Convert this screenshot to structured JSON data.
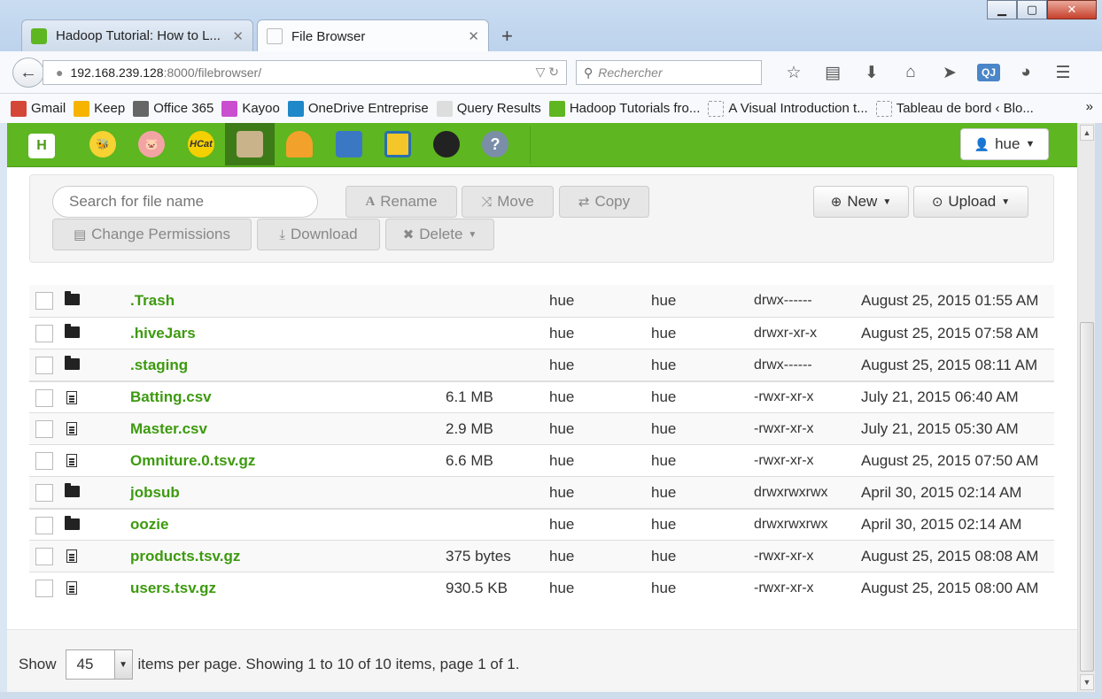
{
  "browser": {
    "tabs": [
      {
        "label": "Hadoop Tutorial: How to L...",
        "icon": "hue-leaf-icon"
      },
      {
        "label": "File Browser",
        "icon": "file-browser-icon"
      }
    ],
    "new_tab": "+",
    "url_host": "192.168.239.128",
    "url_path": ":8000/filebrowser/",
    "search_placeholder": "Rechercher",
    "bookmarks": [
      {
        "label": "Gmail",
        "color": "#d44638"
      },
      {
        "label": "Keep",
        "color": "#f6b400"
      },
      {
        "label": "Office 365",
        "color": "#666666"
      },
      {
        "label": "Kayoo",
        "color": "#c94fcf"
      },
      {
        "label": "OneDrive Entreprise",
        "color": "#1e88c9"
      },
      {
        "label": "Query Results",
        "color": "#bbbbbb"
      },
      {
        "label": "Hadoop Tutorials fro...",
        "color": "#5eb621"
      },
      {
        "label": "A Visual Introduction t...",
        "color": "#cccccc"
      },
      {
        "label": "Tableau de bord ‹ Blo...",
        "color": "#cccccc"
      }
    ],
    "qj_label": "QJ"
  },
  "hue": {
    "user_label": "hue",
    "apps": [
      {
        "name": "hive-icon",
        "label": "",
        "bg": "#f6d233",
        "active": false
      },
      {
        "name": "pig-icon",
        "label": "",
        "bg": "#f2a4a4",
        "active": false
      },
      {
        "name": "hcat-icon",
        "label": "HCat",
        "bg": "#f4d000",
        "active": false
      },
      {
        "name": "file-browser-icon",
        "label": "",
        "bg": "#c8b38a",
        "active": true
      },
      {
        "name": "job-designer-icon",
        "label": "",
        "bg": "#f2a22a",
        "active": false
      },
      {
        "name": "oozie-icon",
        "label": "",
        "bg": "#3b78c4",
        "active": false
      },
      {
        "name": "metastore-icon",
        "label": "",
        "bg": "#f5c629",
        "active": false
      },
      {
        "name": "security-icon",
        "label": "",
        "bg": "#222222",
        "active": false
      },
      {
        "name": "help-icon",
        "label": "?",
        "bg": "#7a8ea8",
        "active": false
      }
    ]
  },
  "actions": {
    "search_placeholder": "Search for file name",
    "rename": "Rename",
    "move": "Move",
    "copy": "Copy",
    "new": "New",
    "upload": "Upload",
    "change_permissions": "Change Permissions",
    "download": "Download",
    "delete": "Delete"
  },
  "files": [
    {
      "type": "folder",
      "name": ".Trash",
      "size": "",
      "user": "hue",
      "group": "hue",
      "perm": "drwx------",
      "date": "August 25, 2015 01:55 AM"
    },
    {
      "type": "folder",
      "name": ".hiveJars",
      "size": "",
      "user": "hue",
      "group": "hue",
      "perm": "drwxr-xr-x",
      "date": "August 25, 2015 07:58 AM"
    },
    {
      "type": "folder",
      "name": ".staging",
      "size": "",
      "user": "hue",
      "group": "hue",
      "perm": "drwx------",
      "date": "August 25, 2015 08:11 AM"
    },
    {
      "type": "file",
      "name": "Batting.csv",
      "size": "6.1 MB",
      "user": "hue",
      "group": "hue",
      "perm": "-rwxr-xr-x",
      "date": "July 21, 2015 06:40 AM"
    },
    {
      "type": "file",
      "name": "Master.csv",
      "size": "2.9 MB",
      "user": "hue",
      "group": "hue",
      "perm": "-rwxr-xr-x",
      "date": "July 21, 2015 05:30 AM"
    },
    {
      "type": "file",
      "name": "Omniture.0.tsv.gz",
      "size": "6.6 MB",
      "user": "hue",
      "group": "hue",
      "perm": "-rwxr-xr-x",
      "date": "August 25, 2015 07:50 AM"
    },
    {
      "type": "folder",
      "name": "jobsub",
      "size": "",
      "user": "hue",
      "group": "hue",
      "perm": "drwxrwxrwx",
      "date": "April 30, 2015 02:14 AM"
    },
    {
      "type": "folder",
      "name": "oozie",
      "size": "",
      "user": "hue",
      "group": "hue",
      "perm": "drwxrwxrwx",
      "date": "April 30, 2015 02:14 AM"
    },
    {
      "type": "file",
      "name": "products.tsv.gz",
      "size": "375 bytes",
      "user": "hue",
      "group": "hue",
      "perm": "-rwxr-xr-x",
      "date": "August 25, 2015 08:08 AM"
    },
    {
      "type": "file",
      "name": "users.tsv.gz",
      "size": "930.5 KB",
      "user": "hue",
      "group": "hue",
      "perm": "-rwxr-xr-x",
      "date": "August 25, 2015 08:00 AM"
    }
  ],
  "footer": {
    "show": "Show",
    "per_page": "45",
    "summary": "items per page. Showing 1 to 10 of 10 items, page 1 of 1."
  }
}
